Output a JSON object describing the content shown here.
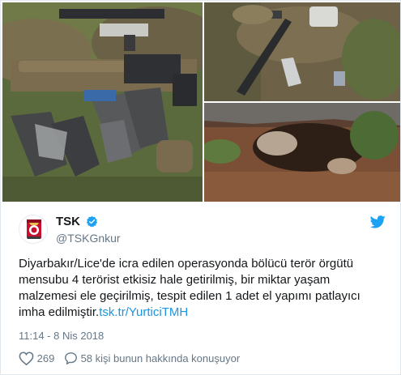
{
  "account": {
    "name": "TSK",
    "handle": "@TSKGnkur",
    "verified": true
  },
  "tweet": {
    "text_before_link": "Diyarbakır/Lice'de icra edilen operasyonda bölücü terör örgütü mensubu 4 terörist etkisiz hale getirilmiş, bir miktar yaşam malzemesi ele geçirilmiş, tespit edilen 1 adet el yapımı patlayıcı imha edilmiştir.",
    "link_text": "tsk.tr/YurticiTMH",
    "timestamp": "11:14 - 8 Nis 2018"
  },
  "actions": {
    "likes": "269",
    "conversation": "58 kişi bunun hakkında konuşuyor"
  },
  "colors": {
    "link": "#1b95e0",
    "muted": "#657786",
    "verified": "#1da1f2",
    "twitter_bird": "#1da1f2"
  },
  "icons": {
    "verified": "verified-badge-icon",
    "bird": "twitter-bird-icon",
    "like": "heart-icon",
    "reply": "speech-bubble-icon"
  }
}
